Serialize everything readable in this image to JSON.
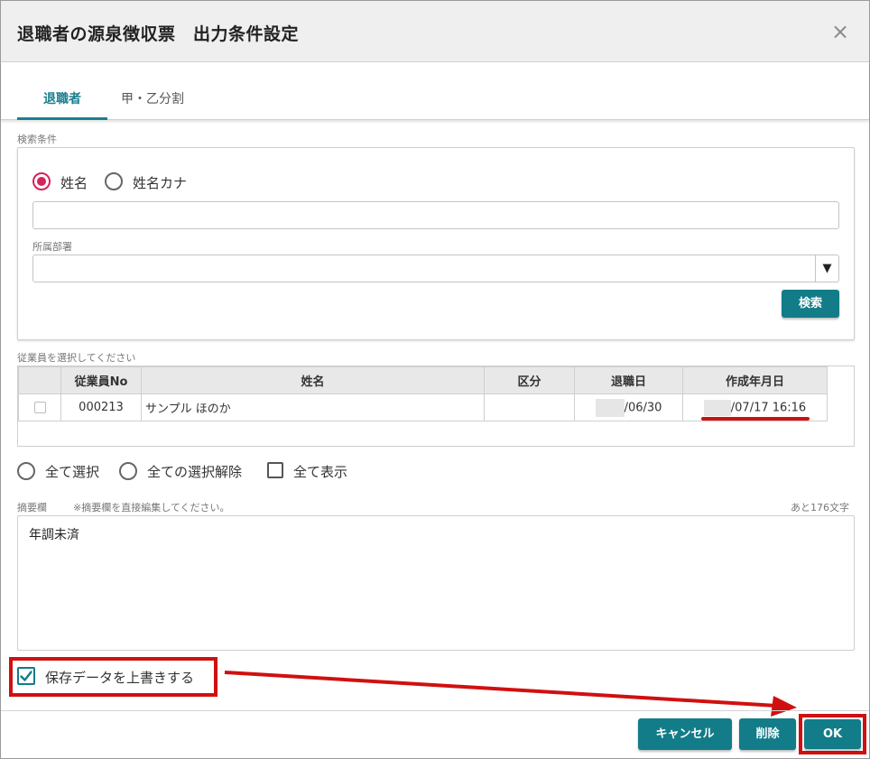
{
  "dialog": {
    "title": "退職者の源泉徴収票　出力条件設定",
    "close_icon": "×"
  },
  "tabs": [
    {
      "label": "退職者",
      "active": true
    },
    {
      "label": "甲・乙分割",
      "active": false
    }
  ],
  "search": {
    "section_label": "検索条件",
    "radio_name": "姓名",
    "radio_kana": "姓名カナ",
    "name_value": "",
    "dept_label": "所属部署",
    "dept_value": "",
    "dept_arrow": "▼",
    "search_button": "検索"
  },
  "employees": {
    "section_label": "従業員を選択してください",
    "columns": [
      "",
      "従業員No",
      "姓名",
      "区分",
      "退職日",
      "作成年月日"
    ],
    "rows": [
      {
        "no": "000213",
        "name": "サンプル ほのか",
        "kubun": "",
        "retire_date": "/06/30",
        "created": "/07/17 16:16"
      }
    ]
  },
  "selection": {
    "select_all": "全て選択",
    "deselect_all": "全ての選択解除",
    "show_all": "全て表示"
  },
  "memo": {
    "label": "摘要欄",
    "note": "※摘要欄を直接編集してください。",
    "remaining": "あと176文字",
    "value": "年調未済"
  },
  "overwrite": {
    "label": "保存データを上書きする",
    "checked": true
  },
  "footer": {
    "cancel": "キャンセル",
    "delete": "削除",
    "ok": "OK"
  },
  "colors": {
    "accent": "#127c88",
    "radio_selected": "#d6235c",
    "annotation_red": "#d01010"
  }
}
